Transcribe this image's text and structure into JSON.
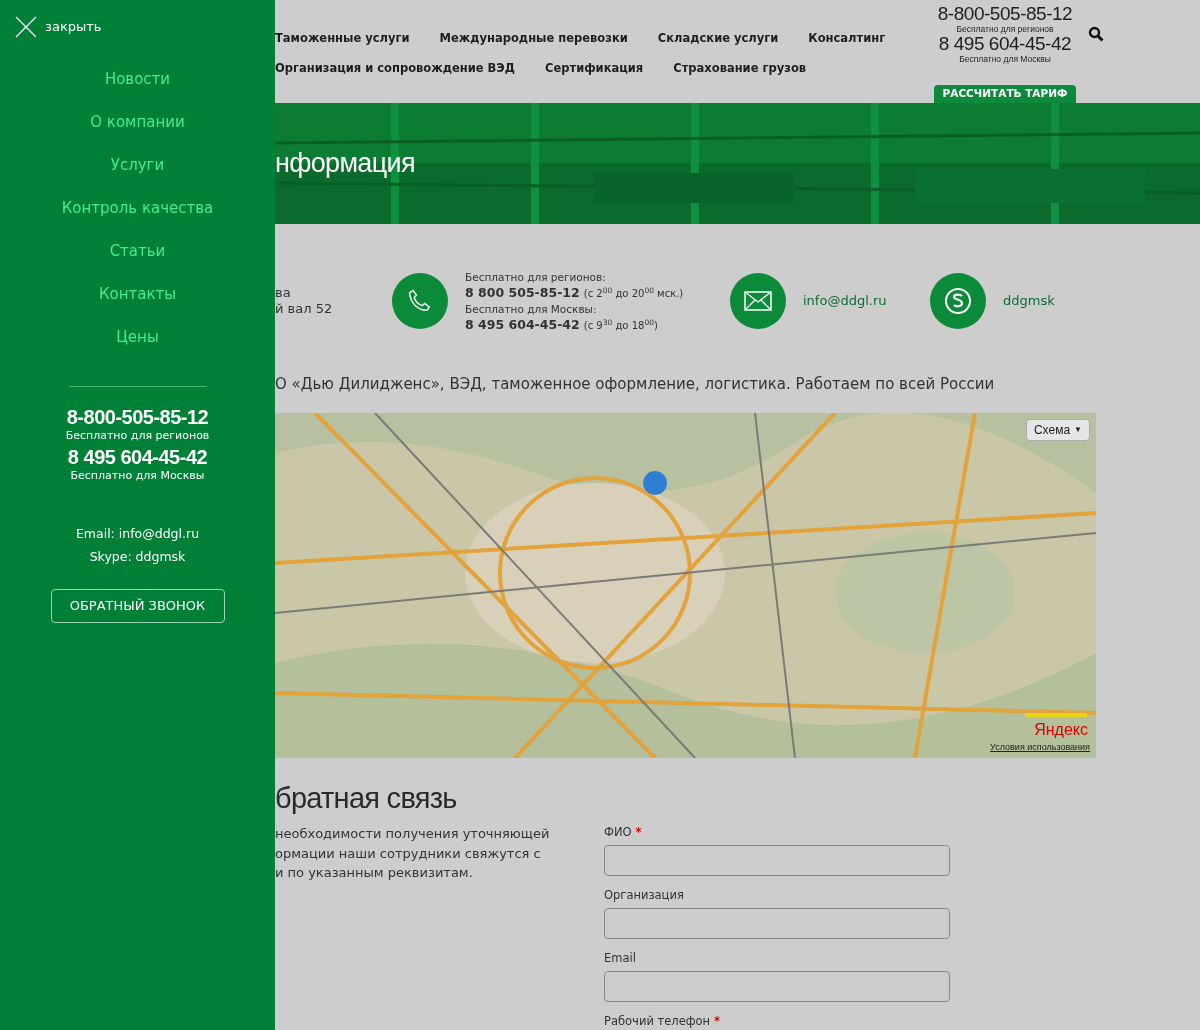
{
  "sidebar": {
    "close_label": "закрыть",
    "menu": [
      {
        "label": "Новости"
      },
      {
        "label": "О компании"
      },
      {
        "label": "Услуги"
      },
      {
        "label": "Контроль качества"
      },
      {
        "label": "Статьи"
      },
      {
        "label": "Контакты"
      },
      {
        "label": "Цены"
      }
    ],
    "phones": [
      {
        "number": "8-800-505-85-12",
        "note": "Бесплатно для регионов"
      },
      {
        "number": "8 495 604-45-42",
        "note": "Бесплатно для Москвы"
      }
    ],
    "email": "Email: info@ddgl.ru",
    "skype": "Skype: ddgmsk",
    "callback_button": "ОБРАТНЫЙ ЗВОНОК"
  },
  "header": {
    "nav_rows": [
      [
        "Таможенные услуги",
        "Международные перевозки",
        "Складские услуги",
        "Консалтинг"
      ],
      [
        "Организация и сопровождение ВЭД",
        "Сертификация",
        "Страхование грузов"
      ]
    ],
    "phones": [
      {
        "number": "8-800-505-85-12",
        "note": "Бесплатно для регионов"
      },
      {
        "number": "8 495 604-45-42",
        "note": "Бесплатно для Москвы"
      }
    ],
    "tariff_button": "РАССЧИТАТЬ ТАРИФ"
  },
  "hero": {
    "title": "нформация"
  },
  "contacts": {
    "address_lines": [
      "ва",
      "й вал 52"
    ],
    "phone_lines": [
      {
        "kind": "label",
        "text": "Бесплатно для регионов:"
      },
      {
        "kind": "number",
        "text": "8 800 505-85-12",
        "hours": "(с 2$^{00}$ до 20$^{00}$ мск.)"
      },
      {
        "kind": "label",
        "text": "Бесплатно для Москвы:"
      },
      {
        "kind": "number",
        "text": "8 495 604-45-42",
        "hours": "(с 9$^{30}$ до 18$^{00}$)"
      }
    ],
    "email": "info@ddgl.ru",
    "skype": "ddgmsk"
  },
  "description": "О «Дью Дилидженс», ВЭД, таможенное оформление, логистика. Работаем по всей России",
  "map": {
    "kind": "picture",
    "layer_button": "Схема",
    "layer_caret": "▼",
    "logo": "Яндекс",
    "terms": "Условия использования"
  },
  "feedback": {
    "title": "братная связь",
    "required_mark": "*",
    "intro_lines": [
      "необходимости получения уточняющей",
      "ормации наши сотрудники свяжутся с",
      "и по указанным реквизитам."
    ],
    "fields": [
      {
        "label": "ФИО",
        "required": true
      },
      {
        "label": "Организация",
        "required": false
      },
      {
        "label": "Email",
        "required": false
      }
    ],
    "next_label": {
      "label": "Рабочий телефон",
      "required": true
    }
  }
}
